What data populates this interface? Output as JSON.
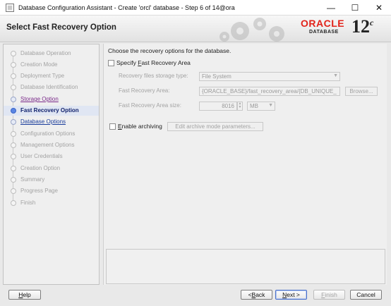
{
  "window": {
    "title": "Database Configuration Assistant - Create 'orcl' database - Step 6 of 14@ora",
    "minimize": "—",
    "maximize": "☐",
    "close": "✕"
  },
  "header": {
    "page_title": "Select Fast Recovery Option",
    "logo_text": "ORACLE",
    "logo_sub": "DATABASE",
    "version": "12",
    "version_sup": "c"
  },
  "steps": [
    {
      "label": "Database Operation",
      "state": "done"
    },
    {
      "label": "Creation Mode",
      "state": "done"
    },
    {
      "label": "Deployment Type",
      "state": "done"
    },
    {
      "label": "Database Identification",
      "state": "done"
    },
    {
      "label": "Storage Option",
      "state": "link"
    },
    {
      "label": "Fast Recovery Option",
      "state": "current"
    },
    {
      "label": "Database Options",
      "state": "link2"
    },
    {
      "label": "Configuration Options",
      "state": "todo"
    },
    {
      "label": "Management Options",
      "state": "todo"
    },
    {
      "label": "User Credentials",
      "state": "todo"
    },
    {
      "label": "Creation Option",
      "state": "todo"
    },
    {
      "label": "Summary",
      "state": "todo"
    },
    {
      "label": "Progress Page",
      "state": "todo"
    },
    {
      "label": "Finish",
      "state": "todo"
    }
  ],
  "main": {
    "intro": "Choose the recovery options for the database.",
    "specify_fra_pre": "Specify ",
    "specify_fra_u": "F",
    "specify_fra_post": "ast Recovery Area",
    "storage_type_label": "Recovery files storage type:",
    "storage_type_value": "File System",
    "fra_label": "Fast Recovery Area:",
    "fra_value": "{ORACLE_BASE}/fast_recovery_area/{DB_UNIQUE_",
    "browse_label": "Browse...",
    "fra_size_label": "Fast Recovery Area size:",
    "fra_size_value": "8016",
    "fra_size_unit": "MB",
    "archiving_pre": "",
    "archiving_u": "E",
    "archiving_post": "nable archiving",
    "edit_archive_label": "Edit archive mode parameters..."
  },
  "buttons": {
    "help_u": "H",
    "help_rest": "elp",
    "back_pre": "< ",
    "back_u": "B",
    "back_rest": "ack",
    "next_u": "N",
    "next_rest": "ext >",
    "finish_u": "F",
    "finish_rest": "inish",
    "cancel": "Cancel"
  }
}
